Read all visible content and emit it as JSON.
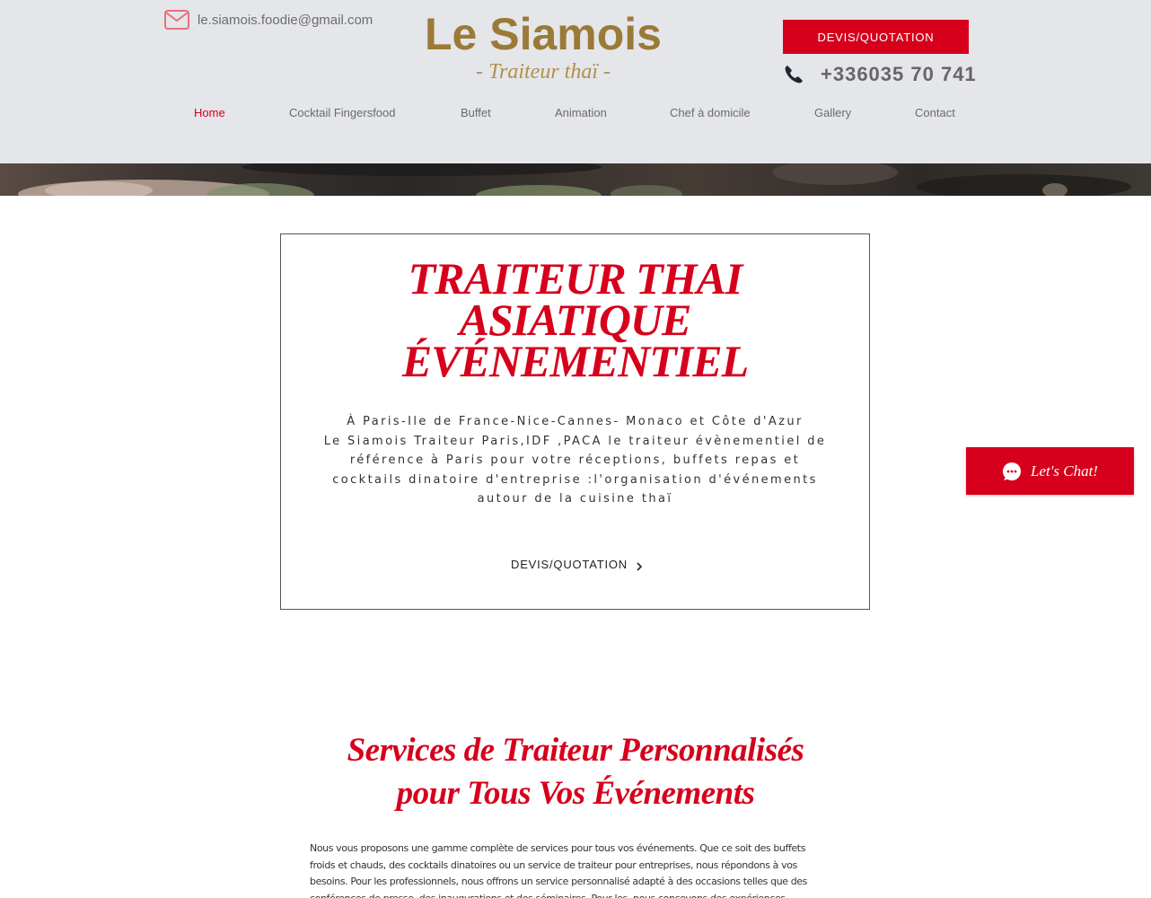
{
  "header": {
    "email": "le.siamois.foodie@gmail.com",
    "logo_main": "Le Siamois",
    "logo_sub": "- Traiteur thaï -",
    "quote_button": "DEVIS/QUOTATION",
    "phone": "+336035 70 741",
    "colors": {
      "background": "#e4e6e9",
      "accent": "#d6001c",
      "gold": "#9b7a37"
    }
  },
  "nav": {
    "items": [
      {
        "label": "Home",
        "active": true
      },
      {
        "label": "Cocktail Fingersfood"
      },
      {
        "label": "Buffet"
      },
      {
        "label": "Animation"
      },
      {
        "label": "Chef à domicile"
      },
      {
        "label": "Gallery"
      },
      {
        "label": "Contact"
      }
    ]
  },
  "hero": {
    "title_lines": [
      "TRAITEUR THAI",
      "ASIATIQUE",
      "ÉVÉNEMENTIEL"
    ],
    "description_lines": [
      "À Paris-Ile de France-Nice-Cannes- Monaco et Côte d'Azur",
      "Le Siamois Traiteur Paris,IDF ,PACA le traiteur évènementiel de",
      "référence à Paris pour votre réceptions, buffets repas et",
      "cocktails dinatoire  d'entreprise :l'organisation d'événements",
      "autour de la cuisine thaï"
    ],
    "link_label": "DEVIS/QUOTATION"
  },
  "chat": {
    "label": "Let's Chat!"
  },
  "services": {
    "title_lines": [
      "Services de Traiteur Personnalisés",
      "pour Tous Vos Événements"
    ],
    "text_lines": [
      "Nous vous proposons une gamme complète de services pour tous vos événements. Que ce soit des buffets",
      "froids et chauds, des cocktails dinatoires ou un service de traiteur pour entreprises, nous répondons à vos",
      "besoins. Pour les professionnels, nous offrons un service personnalisé adapté à des occasions telles que des",
      "conférences de presse, des inaugurations et des séminaires. Pour les, nous concevons des expériences"
    ]
  }
}
